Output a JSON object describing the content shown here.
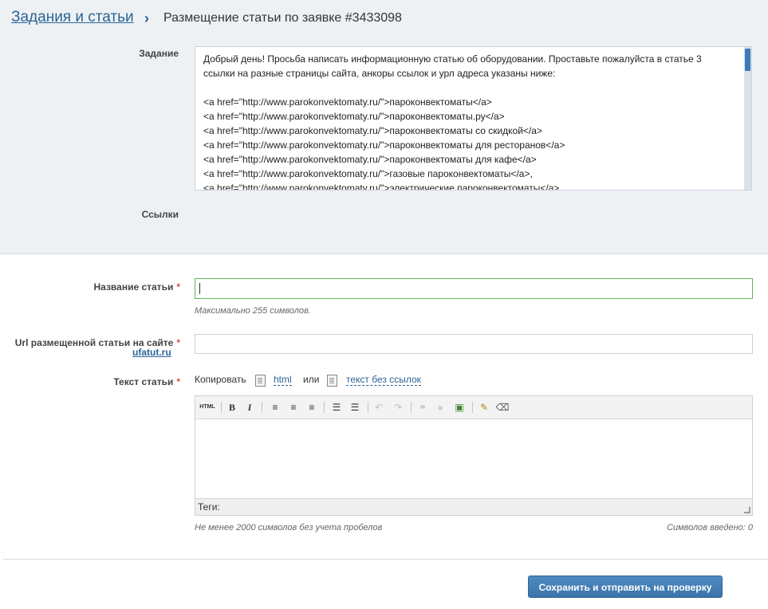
{
  "breadcrumb": {
    "parent_link": "Задания и статьи",
    "separator": "›",
    "current": "Размещение статьи по заявке #3433098"
  },
  "task": {
    "label": "Задание",
    "text": "Добрый день! Просьба написать информационную статью об оборудовании. Проставьте пожалуйста в статье 3 ссылки на разные страницы сайта, анкоры ссылок и урл адреса указаны ниже:\n\n<a href=\"http://www.parokonvektomaty.ru/\">пароконвектоматы</a>\n<a href=\"http://www.parokonvektomaty.ru/\">пароконвектоматы.ру</a>\n<a href=\"http://www.parokonvektomaty.ru/\">пароконвектоматы со скидкой</a>\n<a href=\"http://www.parokonvektomaty.ru/\">пароконвектоматы для ресторанов</a>\n<a href=\"http://www.parokonvektomaty.ru/\">пароконвектоматы для кафе</a>\n<a href=\"http://www.parokonvektomaty.ru/\">газовые пароконвектоматы</a>,\n<a href=\"http://www.parokonvektomaty.ru/\">электрические пароконвектоматы</a>"
  },
  "links": {
    "label": "Ссылки"
  },
  "form": {
    "title": {
      "label": "Название статьи",
      "required_mark": "*",
      "value": "",
      "hint": "Максимально 255 символов."
    },
    "url": {
      "label": "Url размещенной статьи на сайте",
      "site": "ufatut.ru",
      "required_mark": "*",
      "value": ""
    },
    "text": {
      "label": "Текст статьи",
      "required_mark": "*",
      "copy_label": "Копировать",
      "copy_html": "html",
      "copy_or": "или",
      "copy_nolinks": "текст без ссылок",
      "tags_label": "Теги:",
      "min_hint": "Не менее 2000 символов без учета пробелов",
      "count_hint": "Символов введено: 0"
    }
  },
  "toolbar": {
    "html": "HTML",
    "bold": "B",
    "italic": "I",
    "align_left": "≡",
    "align_center": "≡",
    "align_right": "≡",
    "bullets": "☰",
    "numbers": "☰",
    "undo": "↶",
    "redo": "↷",
    "link": "⚭",
    "unlink": "⚹",
    "image": "▣",
    "clean": "✎",
    "eraser": "⌫"
  },
  "actions": {
    "submit": "Сохранить и отправить на проверку"
  }
}
